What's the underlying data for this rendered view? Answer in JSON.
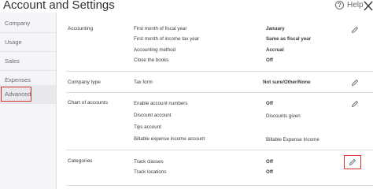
{
  "header": {
    "title": "Account and Settings",
    "help_label": "Help"
  },
  "sidebar": {
    "items": [
      {
        "label": "Company"
      },
      {
        "label": "Usage"
      },
      {
        "label": "Sales"
      },
      {
        "label": "Expenses"
      },
      {
        "label": "Advanced"
      }
    ]
  },
  "sections": {
    "accounting": {
      "label": "Accounting",
      "rows": [
        {
          "field": "First month of fiscal year",
          "value": "January"
        },
        {
          "field": "First month of income tax year",
          "value": "Same as fiscal year"
        },
        {
          "field": "Accounting method",
          "value": "Accrual"
        },
        {
          "field": "Close the books",
          "value": "Off"
        }
      ]
    },
    "company_type": {
      "label": "Company type",
      "rows": [
        {
          "field": "Tax form",
          "value": "Not sure/Other/None"
        }
      ]
    },
    "chart_of_accounts": {
      "label": "Chart of accounts",
      "rows": [
        {
          "field": "Enable account numbers",
          "value": "Off"
        },
        {
          "field": "Discount account",
          "value": "Discounts given"
        },
        {
          "field": "Tips account",
          "value": ""
        },
        {
          "field": "Billable expense income account",
          "value": "Billable Expense Income"
        }
      ]
    },
    "categories": {
      "label": "Categories",
      "rows": [
        {
          "field": "Track classes",
          "value": "Off"
        },
        {
          "field": "Track locations",
          "value": "Off"
        }
      ]
    }
  },
  "colors": {
    "highlight": "#d8342c",
    "sidebar_bg": "#f4f5f8"
  },
  "icons": {
    "edit": "pencil-icon",
    "help": "help-icon",
    "close": "close-icon"
  }
}
